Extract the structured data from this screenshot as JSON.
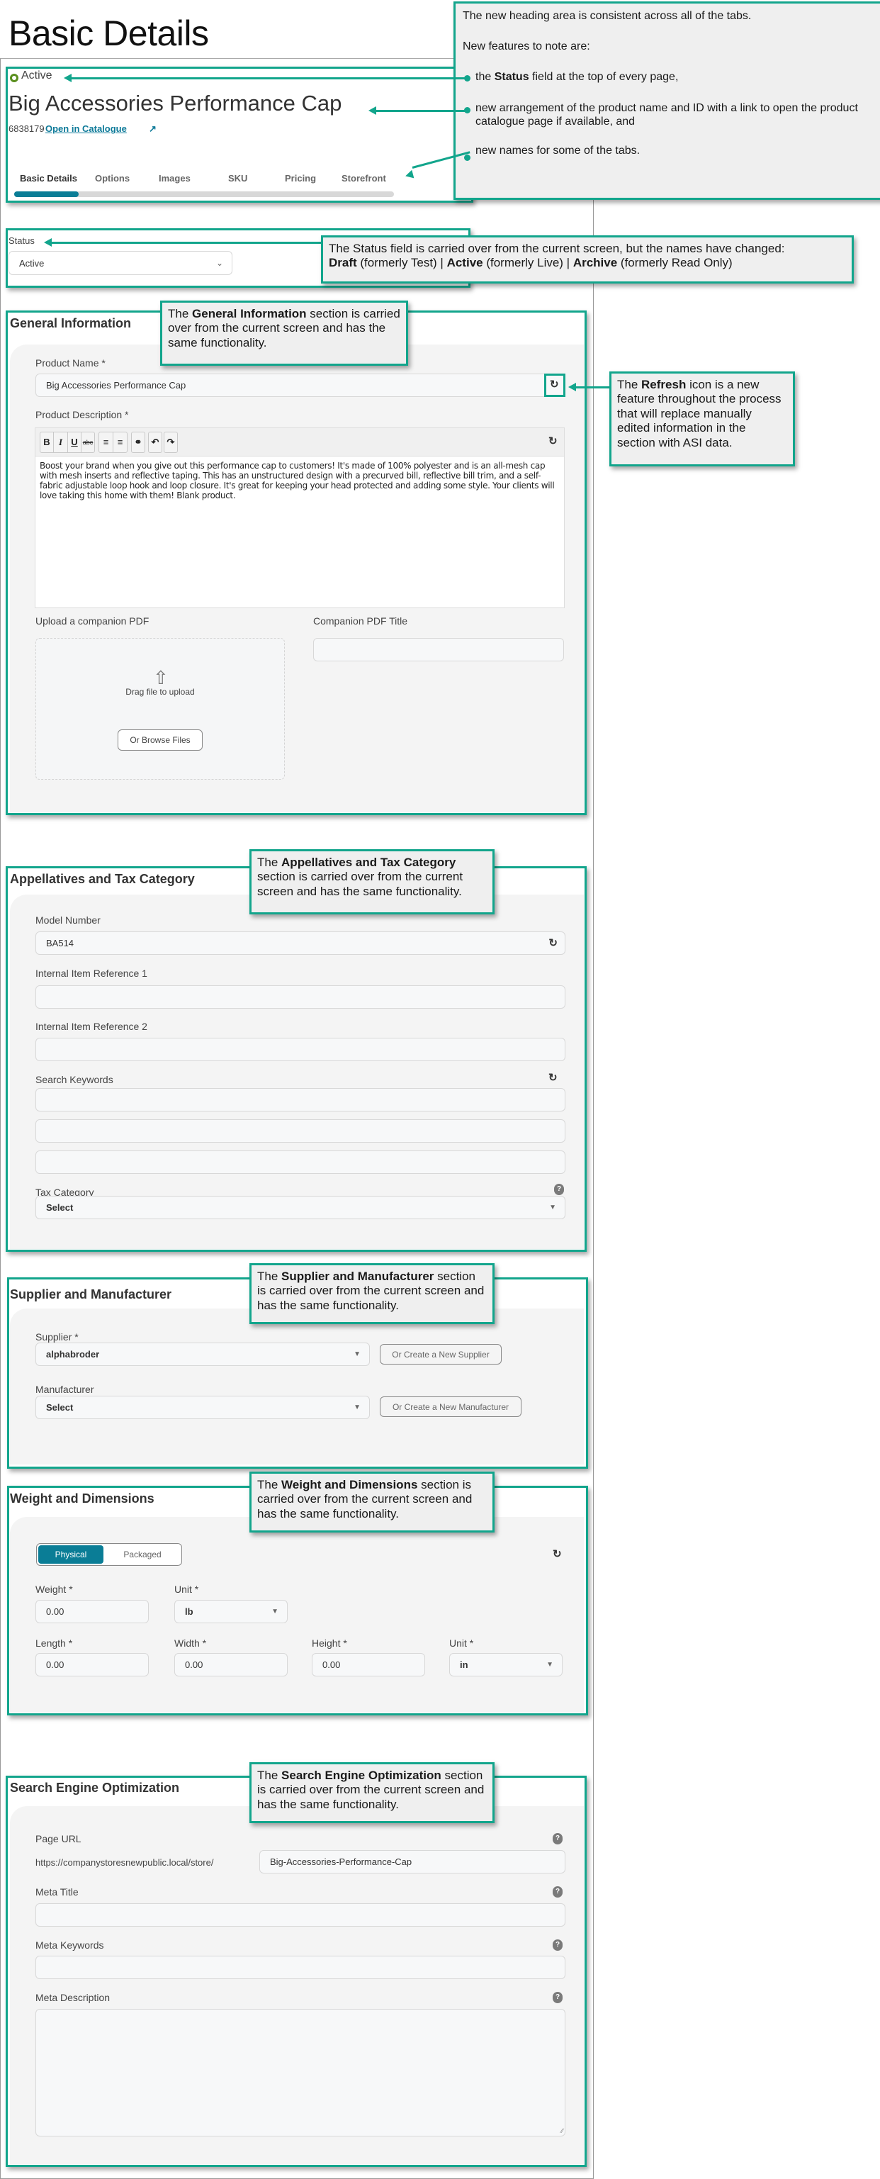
{
  "page": {
    "heading": "Basic Details"
  },
  "header": {
    "status": "Active",
    "product_name": "Big Accessories Performance Cap",
    "product_id": "6838179",
    "catalogue_link": "Open in Catalogue",
    "tabs": [
      {
        "label": "Basic Details",
        "active": true
      },
      {
        "label": "Options",
        "active": false
      },
      {
        "label": "Images",
        "active": false
      },
      {
        "label": "SKU",
        "active": false
      },
      {
        "label": "Pricing",
        "active": false
      },
      {
        "label": "Storefront",
        "active": false
      }
    ],
    "tab_progress_fraction": 0.17
  },
  "status_field": {
    "label": "Status",
    "value": "Active"
  },
  "general_information": {
    "title": "General Information",
    "product_name_label": "Product Name *",
    "product_name_value": "Big Accessories Performance Cap",
    "product_description_label": "Product Description *",
    "editor_buttons": [
      "B",
      "I",
      "U",
      "abc",
      "bulleted-list",
      "numbered-list",
      "link",
      "undo",
      "redo"
    ],
    "product_description_value": "Boost your brand when you give out this performance cap to customers! It's made of 100% polyester and is an all-mesh cap with mesh inserts and reflective taping. This has an unstructured design with a precurved bill, reflective bill trim, and a self-fabric adjustable loop hook and loop closure. It's great for keeping your head protected and adding some style. Your clients will love taking this home with them! Blank product.",
    "upload_label": "Upload a companion PDF",
    "drag_text": "Drag file to upload",
    "browse_button": "Or Browse Files",
    "pdf_title_label": "Companion PDF Title",
    "pdf_title_value": ""
  },
  "appellatives": {
    "title": "Appellatives and Tax Category",
    "model_number_label": "Model Number",
    "model_number_value": "BA514",
    "internal_ref_1_label": "Internal Item Reference 1",
    "internal_ref_1_value": "",
    "internal_ref_2_label": "Internal Item Reference 2",
    "internal_ref_2_value": "",
    "search_keywords_label": "Search Keywords",
    "search_keywords_values": [
      "",
      "",
      ""
    ],
    "tax_category_label": "Tax Category",
    "tax_category_value": "Select"
  },
  "supplier": {
    "title": "Supplier and Manufacturer",
    "supplier_label": "Supplier *",
    "supplier_value": "alphabroder",
    "create_supplier_button": "Or Create a New Supplier",
    "manufacturer_label": "Manufacturer",
    "manufacturer_value": "Select",
    "create_manufacturer_button": "Or Create a New Manufacturer"
  },
  "weight": {
    "title": "Weight and Dimensions",
    "toggle_options": [
      "Physical",
      "Packaged"
    ],
    "toggle_selected": "Physical",
    "weight_label": "Weight *",
    "weight_value": "0.00",
    "weight_unit_label": "Unit *",
    "weight_unit_value": "lb",
    "length_label": "Length *",
    "length_value": "0.00",
    "width_label": "Width *",
    "width_value": "0.00",
    "height_label": "Height *",
    "height_value": "0.00",
    "dim_unit_label": "Unit *",
    "dim_unit_value": "in"
  },
  "seo": {
    "title": "Search Engine Optimization",
    "page_url_label": "Page URL",
    "page_url_prefix": "https://companystoresnewpublic.local/store/",
    "page_url_value": "Big-Accessories-Performance-Cap",
    "meta_title_label": "Meta Title",
    "meta_title_value": "",
    "meta_keywords_label": "Meta Keywords",
    "meta_keywords_value": "",
    "meta_description_label": "Meta Description",
    "meta_description_value": ""
  },
  "annotations": {
    "heading_note": {
      "line1": "The new heading area is consistent across all of the tabs.",
      "line2": "New features to note are:",
      "bullet1_pre": "the ",
      "bullet1_bold": "Status",
      "bullet1_post": " field at the top of every page,",
      "bullet2": "new arrangement of the product name and ID with a link to open the product catalogue page if available, and",
      "bullet3": "new names for some of the tabs."
    },
    "status_note": {
      "line1": "The Status field is carried over from the current screen, but the names have changed:",
      "draft": "Draft",
      "draft_old": " (formerly Test) | ",
      "active": "Active",
      "active_old": " (formerly Live) | ",
      "archive": "Archive",
      "archive_old": " (formerly Read Only)"
    },
    "general_note": {
      "pre": "The ",
      "bold": "General Information",
      "post": " section is carried over from the current screen and has the same functionality."
    },
    "refresh_note": {
      "pre": "The ",
      "bold": "Refresh",
      "post": " icon is a new feature throughout the process that will replace manually edited information in the section with ASI data."
    },
    "appellatives_note": {
      "pre": "The ",
      "bold": "Appellatives and Tax Category",
      "post": " section is carried over from the current screen and has the same functionality."
    },
    "supplier_note": {
      "pre": "The ",
      "bold": "Supplier and Manufacturer",
      "post": " section is carried over from the current screen and has the same functionality."
    },
    "weight_note": {
      "pre": "The ",
      "bold": "Weight and Dimensions",
      "post": " section is carried over from the current screen and has the same functionality."
    },
    "seo_note": {
      "pre": "The ",
      "bold": "Search Engine Optimization",
      "post": " section is carried over from the current screen and has the same functionality."
    }
  },
  "colors": {
    "annotation_accent": "#12a58c",
    "brand_primary": "#0a7d96",
    "status_active": "#5a8f1e"
  }
}
